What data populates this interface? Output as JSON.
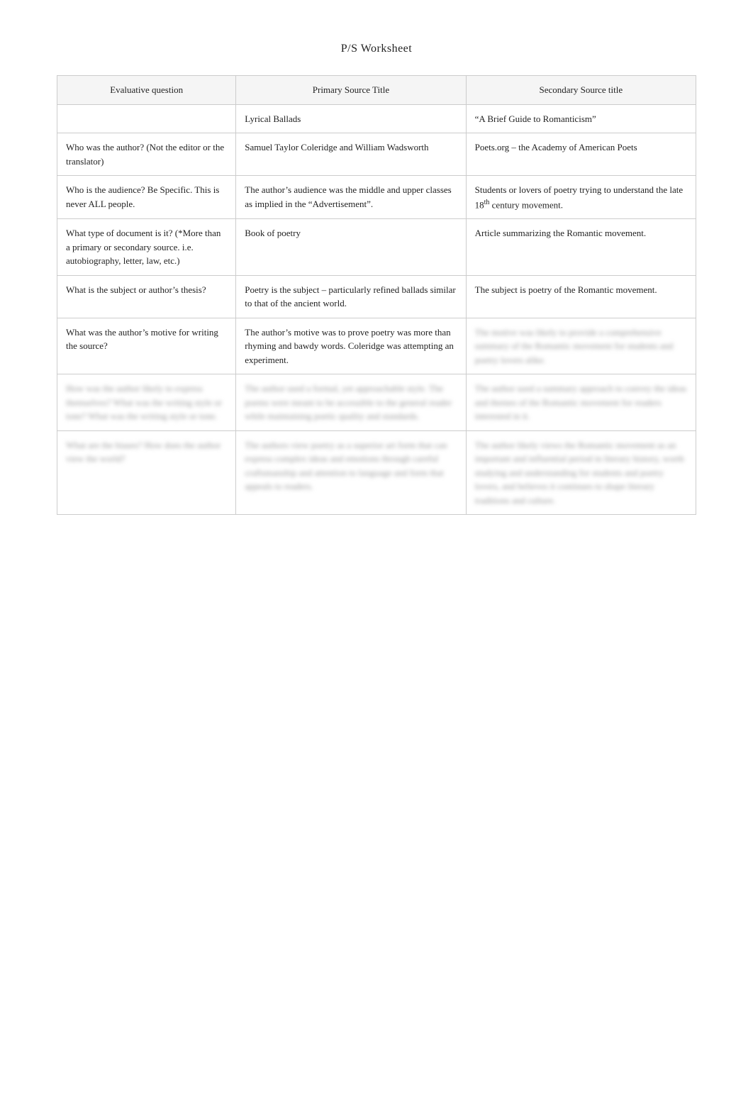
{
  "page": {
    "title": "P/S Worksheet"
  },
  "table": {
    "headers": {
      "col1": "Evaluative question",
      "col2": "Primary Source Title",
      "col3": "Secondary Source title"
    },
    "rows": [
      {
        "id": "titles-row",
        "col1": "",
        "col2": "Lyrical Ballads",
        "col3": "“A Brief Guide to Romanticism”",
        "blurred": false
      },
      {
        "id": "author-row",
        "col1": "Who was the author? (Not the editor or the translator)",
        "col2": "Samuel Taylor Coleridge and William Wadsworth",
        "col3": "Poets.org – the Academy of American Poets",
        "blurred": false
      },
      {
        "id": "audience-row",
        "col1": "Who is the audience?  Be Specific. This is never ALL people.",
        "col2": "The author’s audience was the middle and upper classes as implied in the “Advertisement”.",
        "col3": "Students or lovers of poetry trying to understand the late 18th century movement.",
        "blurred": false
      },
      {
        "id": "doctype-row",
        "col1": "What type of document is it? (*More than a primary or secondary source. i.e. autobiography, letter, law, etc.)",
        "col2": "Book of poetry",
        "col3": "Article summarizing the Romantic movement.",
        "blurred": false
      },
      {
        "id": "subject-row",
        "col1": "What is the subject or author’s thesis?",
        "col2": "Poetry is the subject – particularly refined ballads similar to that of the ancient world.",
        "col3": "The subject is poetry of the Romantic movement.",
        "blurred": false
      },
      {
        "id": "motive-row",
        "col1": "What was the author’s motive for writing the source?",
        "col2": "The author’s motive was to prove poetry was more than rhyming and bawdy words. Coleridge was attempting an experiment.",
        "col3": "The motive was likely to provide a comprehensive summary of the Romantic movement for students and poetry lovers alike.",
        "blurred": true,
        "col3_text": "The motive was likely to provide a comprehensive summary of the Romantic movement for students and poetry lovers alike."
      },
      {
        "id": "blurred-row-1",
        "col1": "How was the author likely to express themselves? What was the writing style or tone?",
        "col2": "The author used a formal, yet approachable style. The poems were meant to be accessible to the general reader while maintaining poetic quality and standards.",
        "col3": "The author used a summary approach to convey the ideas and themes of the Romantic movement.",
        "blurred": true
      },
      {
        "id": "blurred-row-2",
        "col1": "What are the biases? How does the author view the world?",
        "col2": "The authors view poetry as a superior art form that can express complex ideas and emotions through careful craftsmanship and attention to language and form.",
        "col3": "The author likely views the Romantic movement as an important and influential period in literary history, worth studying and understanding for students and poetry lovers.",
        "blurred": true
      }
    ]
  }
}
